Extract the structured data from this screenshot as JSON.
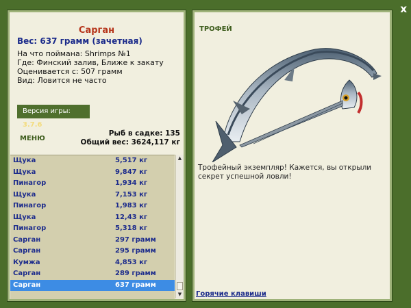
{
  "window": {
    "close_label": "x"
  },
  "fish": {
    "name": "Сарган",
    "weight": "Вес: 637 грамм (зачетная)",
    "bait": "На что поймана: Shrimps №1",
    "location": "Где: Финский залив, Ближе к закату",
    "valued_from": "Оценивается с: 507 грамм",
    "kind": "Вид: Ловится не часто"
  },
  "version": {
    "label": "Версия игры:",
    "value": "3.7.6"
  },
  "menu": {
    "label": "МЕНЮ"
  },
  "stats": {
    "fish_in_cage": "Рыб в садке: 135",
    "total_weight": "Общий вес: 3624,117 кг"
  },
  "catch_list": [
    {
      "name": "Щука",
      "weight": "5,517 кг"
    },
    {
      "name": "Щука",
      "weight": "9,847 кг"
    },
    {
      "name": "Пинагор",
      "weight": "1,934 кг"
    },
    {
      "name": "Щука",
      "weight": "7,153 кг"
    },
    {
      "name": "Пинагор",
      "weight": "1,983 кг"
    },
    {
      "name": "Щука",
      "weight": "12,43 кг"
    },
    {
      "name": "Пинагор",
      "weight": "5,318 кг"
    },
    {
      "name": "Сарган",
      "weight": "297 грамм"
    },
    {
      "name": "Сарган",
      "weight": "295 грамм"
    },
    {
      "name": "Кумжа",
      "weight": "4,853 кг"
    },
    {
      "name": "Сарган",
      "weight": "289 грамм"
    },
    {
      "name": "Сарган",
      "weight": "637 грамм"
    }
  ],
  "selected_index": 11,
  "trophy": {
    "label": "ТРОФЕЙ",
    "text": "Трофейный экземпляр! Кажется, вы открыли секрет успешной ловли!"
  },
  "hotkeys": {
    "label": "Горячие клавиши"
  },
  "colors": {
    "frame": "#4b6e2b",
    "panel": "#f1efdf",
    "accent_title": "#b6361c",
    "link": "#1a2a8a",
    "selection": "#3d8ce4"
  }
}
